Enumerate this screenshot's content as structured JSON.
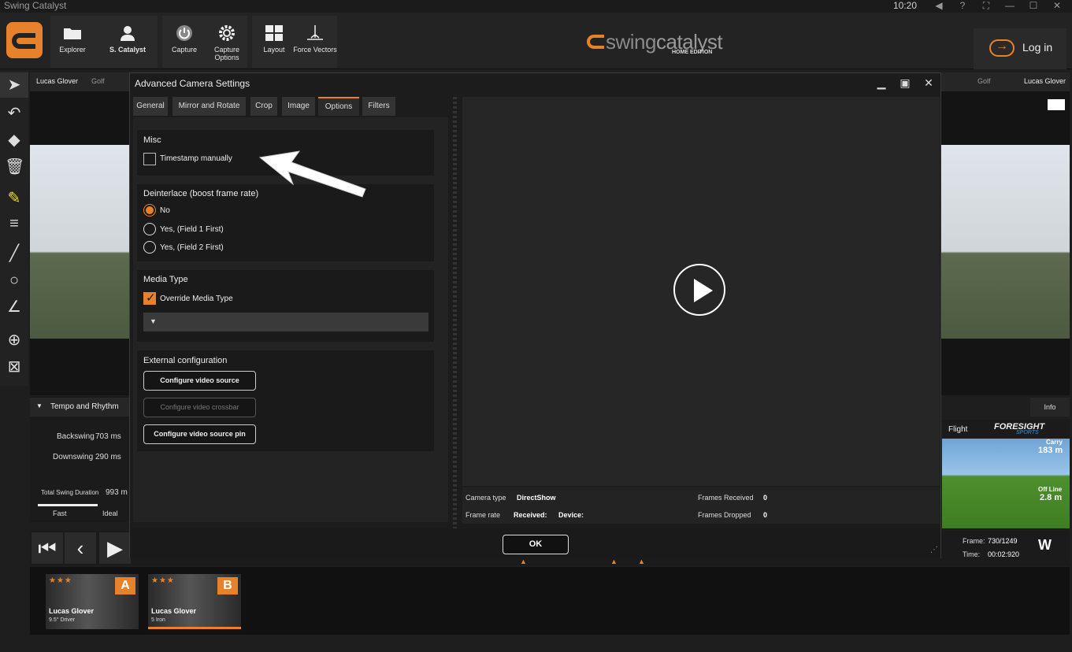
{
  "window": {
    "title": "Swing Catalyst",
    "clock": "10:20"
  },
  "toolbar": {
    "explorer": "Explorer",
    "catalyst": "S. Catalyst",
    "capture": "Capture",
    "capture_options": "Capture Options",
    "layout": "Layout",
    "force_vectors": "Force Vectors",
    "brand_main": "swing",
    "brand_accent": "catalyst",
    "brand_edition": "HOME EDITION",
    "login": "Log in"
  },
  "left_pane": {
    "player": "Lucas Glover",
    "sport": "Golf"
  },
  "right_pane": {
    "sport": "Golf",
    "player": "Lucas Glover",
    "info_tab": "Info",
    "flight_tab": "Flight",
    "brand": "FORESIGHT",
    "brand_sub": "SPORTS",
    "carry_label": "Carry",
    "carry_value": "183 m",
    "offline_label": "Off Line",
    "offline_value": "2.8 m"
  },
  "tempo": {
    "title": "Tempo and Rhythm",
    "backswing_label": "Backswing",
    "backswing_value": "703 ms",
    "downswing_label": "Downswing",
    "downswing_value": "290 ms",
    "total_label": "Total Swing Duration",
    "total_value": "993 m",
    "fast": "Fast",
    "ideal": "Ideal"
  },
  "playback": {
    "frame_label": "Frame:",
    "frame_value": "730/1249",
    "time_label": "Time:",
    "time_value": "00:02:920"
  },
  "thumbnails": [
    {
      "stars": "★★★",
      "badge": "A",
      "name": "Lucas Glover",
      "club": "9.5° Driver"
    },
    {
      "stars": "★★★",
      "badge": "B",
      "name": "Lucas Glover",
      "club": "5 Iron"
    }
  ],
  "dialog": {
    "title": "Advanced Camera Settings",
    "tabs": [
      "General",
      "Mirror and Rotate",
      "Crop",
      "Image",
      "Options",
      "Filters"
    ],
    "misc": {
      "title": "Misc",
      "timestamp": "Timestamp manually"
    },
    "deinterlace": {
      "title": "Deinterlace (boost frame rate)",
      "options": [
        "No",
        "Yes, (Field 1 First)",
        "Yes, (Field 2 First)"
      ]
    },
    "media": {
      "title": "Media Type",
      "override": "Override Media Type"
    },
    "external": {
      "title": "External configuration",
      "btn_source": "Configure video source",
      "btn_crossbar": "Configure video crossbar",
      "btn_pin": "Configure video source pin"
    },
    "info": {
      "camera_type_label": "Camera type",
      "camera_type_value": "DirectShow",
      "frame_rate_label": "Frame rate",
      "received_label": "Received:",
      "device_label": "Device:",
      "frames_received_label": "Frames Received",
      "frames_received_value": "0",
      "frames_dropped_label": "Frames Dropped",
      "frames_dropped_value": "0"
    },
    "ok": "OK"
  }
}
